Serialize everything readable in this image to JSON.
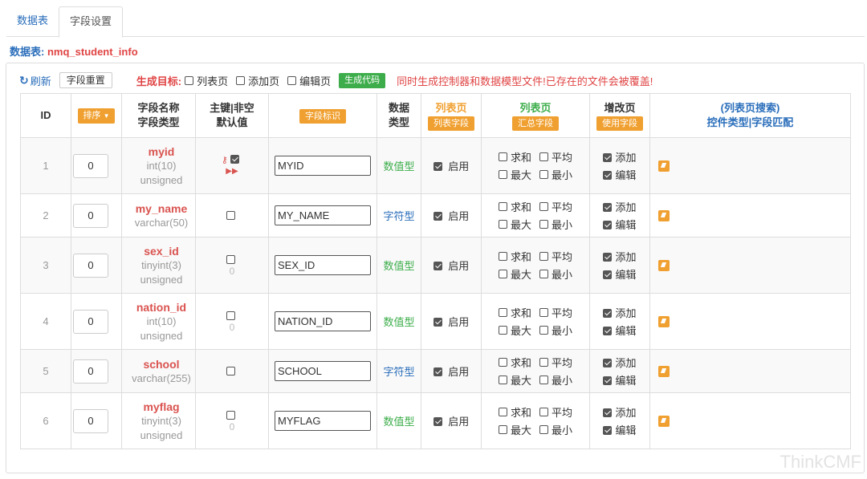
{
  "tabs": [
    {
      "label": "数据表",
      "active": false
    },
    {
      "label": "字段设置",
      "active": true
    }
  ],
  "table_title": {
    "label": "数据表:",
    "value": "nmq_student_info"
  },
  "toolbar": {
    "refresh_label": "刷新",
    "reset_label": "字段重置",
    "gen_target_label": "生成目标:",
    "targets": [
      "列表页",
      "添加页",
      "编辑页"
    ],
    "gen_button": "生成代码",
    "warning": "同时生成控制器和数据模型文件!已存在的文件会被覆盖!"
  },
  "headers": {
    "id": "ID",
    "sort_badge": "排序",
    "field_name": "字段名称",
    "field_type": "字段类型",
    "pk_line1": "主键|非空",
    "pk_line2": "默认值",
    "ident_badge": "字段标识",
    "dtype_line1": "数据",
    "dtype_line2": "类型",
    "list_title": "列表页",
    "list_badge": "列表字段",
    "agg_title": "列表页",
    "agg_badge": "汇总字段",
    "edit_title": "增改页",
    "edit_badge": "使用字段",
    "search_line1": "(列表页搜索)",
    "search_line2": "控件类型|字段匹配"
  },
  "labels": {
    "enable": "启用",
    "sum": "求和",
    "avg": "平均",
    "max": "最大",
    "min": "最小",
    "add": "添加",
    "edit": "编辑"
  },
  "rows": [
    {
      "id": "1",
      "sort": "0",
      "name": "myid",
      "type": "int(10)",
      "unsigned": "unsigned",
      "default": "",
      "ident": "MYID",
      "dtype": "数值型"
    },
    {
      "id": "2",
      "sort": "0",
      "name": "my_name",
      "type": "varchar(50)",
      "unsigned": "",
      "default": "",
      "ident": "MY_NAME",
      "dtype": "字符型"
    },
    {
      "id": "3",
      "sort": "0",
      "name": "sex_id",
      "type": "tinyint(3)",
      "unsigned": "unsigned",
      "default": "0",
      "ident": "SEX_ID",
      "dtype": "数值型"
    },
    {
      "id": "4",
      "sort": "0",
      "name": "nation_id",
      "type": "int(10)",
      "unsigned": "unsigned",
      "default": "0",
      "ident": "NATION_ID",
      "dtype": "数值型"
    },
    {
      "id": "5",
      "sort": "0",
      "name": "school",
      "type": "varchar(255)",
      "unsigned": "",
      "default": "",
      "ident": "SCHOOL",
      "dtype": "字符型"
    },
    {
      "id": "6",
      "sort": "0",
      "name": "myflag",
      "type": "tinyint(3)",
      "unsigned": "unsigned",
      "default": "0",
      "ident": "MYFLAG",
      "dtype": "数值型"
    }
  ],
  "brand": "ThinkCMF",
  "colors": {
    "accent_blue": "#2a6ebb",
    "danger_red": "#e04444",
    "orange": "#f0a030",
    "green": "#3cad4a"
  }
}
